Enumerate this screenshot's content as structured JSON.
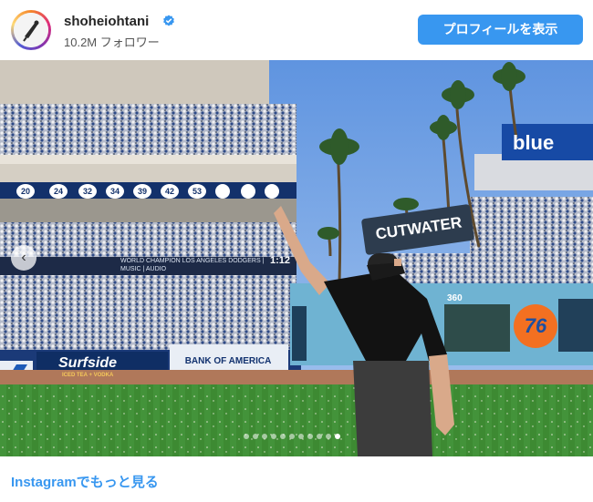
{
  "post": {
    "username": "shoheiohtani",
    "followers": "10.2M フォロワー",
    "profile_button": "プロフィールを表示",
    "more_link": "Instagramでもっと見る",
    "verified_icon": "verified-badge-icon",
    "accent_color": "#3897f0"
  },
  "media": {
    "signs": {
      "cutwater": "CUTWATER",
      "blue": "blue",
      "surfside": "Surfside",
      "surfside_sub": "ICED TEA + VODKA",
      "bank": "BANK OF AMERICA",
      "union76": "76",
      "banner": "WORLD CHAMPION LOS ANGELES DODGERS | MUSIC | AUDIO",
      "section": "360",
      "clock": "1:12"
    },
    "retired_numbers": [
      "20",
      "24",
      "32",
      "34",
      "39",
      "42",
      "53",
      "",
      "",
      "",
      ""
    ],
    "carousel": {
      "total": 11,
      "active_index": 10
    }
  }
}
